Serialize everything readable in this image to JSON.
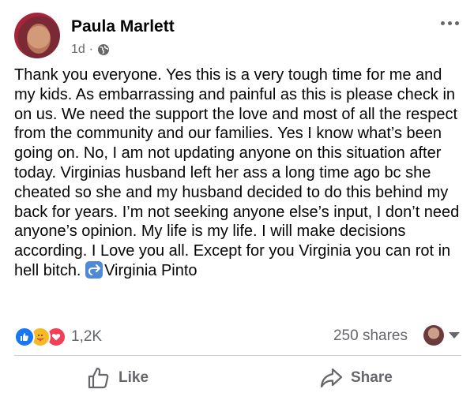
{
  "post": {
    "author": "Paula Marlett",
    "time": "1d",
    "separator": "·",
    "body_text": "Thank you everyone. Yes this is a very tough time for me and my kids. As embarrassing and painful as this is please check in on us. We need the support the love and most of all the respect from the community and our families. Yes I know what’s been going on. No, I am not updating anyone on this situation after today. Virginias husband left her ass a long time ago bc she cheated so she and my husband decided to do this behind my back for years. I’m not seeking anyone else’s input, I don’t need anyone’s opinion. My life is my life. I will make decisions according. I Love you all. Except for you Virginia you can rot in hell bitch. ",
    "tagged_name": "Virginia Pinto"
  },
  "stats": {
    "reactions_count": "1,2K",
    "shares": "250 shares",
    "reaction_types": [
      "like-icon",
      "care-icon",
      "love-icon"
    ]
  },
  "actions": {
    "like_label": "Like",
    "share_label": "Share"
  },
  "colors": {
    "like_blue": "#1877f2",
    "love_red": "#f33e58",
    "care_yellow": "#f7b928",
    "secondary_text": "#65676b"
  }
}
